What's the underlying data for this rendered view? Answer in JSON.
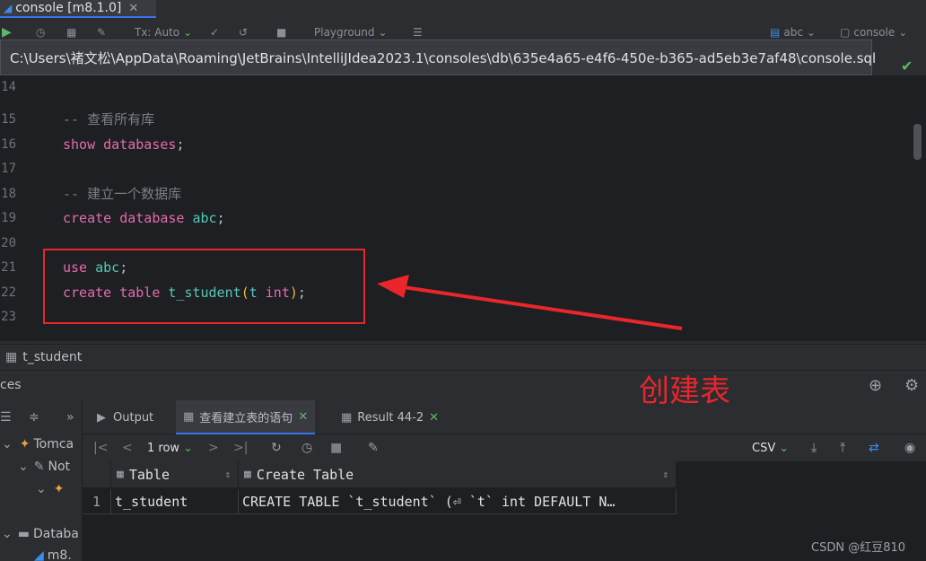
{
  "editor_tab": {
    "label": "console [m8.1.0]"
  },
  "toolbar": {
    "tx_mode": "Tx: Auto",
    "playground": "Playground",
    "schema": "abc",
    "session": "console"
  },
  "path_tooltip": "C:\\Users\\褚文松\\AppData\\Roaming\\JetBrains\\IntelliJIdea2023.1\\consoles\\db\\635e4a65-e4f6-450e-b365-ad5eb3e7af48\\console.sql",
  "line_numbers": [
    "14",
    "15",
    "16",
    "17",
    "18",
    "19",
    "20",
    "21",
    "22",
    "23"
  ],
  "code": {
    "c1": "-- 查看所有库",
    "l16_kw": "show",
    "l16_rest": "databases",
    "l16_semi": ";",
    "c2": "-- 建立一个数据库",
    "l19_kw": "create",
    "l19_kw2": "database",
    "l19_db": "abc",
    "l19_semi": ";",
    "l21_kw": "use",
    "l21_db": "abc",
    "l21_semi": ";",
    "l22_kw": "create",
    "l22_kw2": "table",
    "l22_tbl": "t_student",
    "l22_open": "(",
    "l22_col": "t",
    "l22_type": "int",
    "l22_close": ")",
    "l22_semi": ";"
  },
  "annotation": "创建表",
  "result_title": "t_student",
  "services_label": "ces",
  "tree": {
    "tomcat": "Tomca",
    "not": "Not",
    "database": "Databa",
    "m8": "m8."
  },
  "bottom_tabs": [
    {
      "label": "Output"
    },
    {
      "label": "查看建立表的语句"
    },
    {
      "label": "Result 44-2"
    }
  ],
  "result_toolbar": {
    "rows": "1 row",
    "format": "CSV"
  },
  "grid": {
    "columns": [
      "Table",
      "Create Table"
    ],
    "rows": [
      {
        "index": "1",
        "table": "t_student",
        "create": "CREATE TABLE `t_student` (⏎  `t` int DEFAULT N…"
      }
    ]
  },
  "watermark": "CSDN @红豆810"
}
